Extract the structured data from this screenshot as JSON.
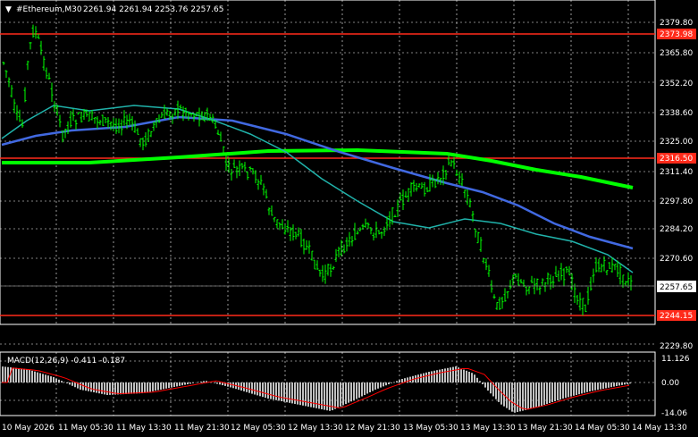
{
  "header": {
    "symbol": "#Ethereum,M30",
    "ohlc": "2261.94 2261.94 2253.76 2257.65"
  },
  "price_axis": {
    "ticks": [
      "2379.80",
      "2365.80",
      "2352.20",
      "2338.60",
      "2325.00",
      "2311.40",
      "2297.80",
      "2284.20",
      "2270.60",
      "2257.65",
      "2243.40",
      "2229.80"
    ],
    "current_price": "2257.65"
  },
  "levels": {
    "resistance": "2373.98",
    "mid": "2316.50",
    "support": "2244.15",
    "color": "#ff2a1a"
  },
  "macd": {
    "label": "MACD(12,26,9) -0.411 -0.187",
    "ticks": [
      "11.126",
      "0.00",
      "-14.06"
    ],
    "histogram_color": "#c0c0c0",
    "signal_color": "#ff0000"
  },
  "time_axis": {
    "labels": [
      "10 May 2026",
      "11 May 05:30",
      "11 May 13:30",
      "11 May 21:30",
      "12 May 05:30",
      "12 May 13:30",
      "12 May 21:30",
      "13 May 05:30",
      "13 May 13:30",
      "13 May 21:30",
      "14 May 05:30",
      "14 May 13:30"
    ]
  },
  "chart_data": {
    "type": "line",
    "y_range": [
      2226,
      2386
    ],
    "series": [],
    "colors": {
      "candle": "#00ff00",
      "ma_fast": "#20b2aa",
      "ma_mid": "#4169e1",
      "ma_slow": "#00ff00"
    }
  }
}
